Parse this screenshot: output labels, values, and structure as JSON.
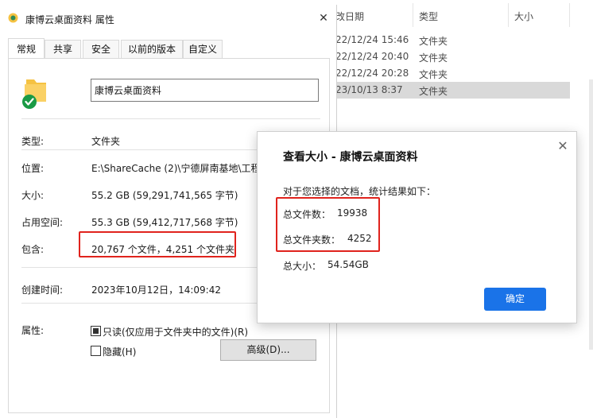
{
  "explorer": {
    "columns": {
      "date": "改日期",
      "type": "类型",
      "size": "大小"
    },
    "rows": [
      {
        "date": "22/12/24 15:46",
        "type": "文件夹",
        "selected": false
      },
      {
        "date": "22/12/24 20:40",
        "type": "文件夹",
        "selected": false
      },
      {
        "date": "22/12/24 20:28",
        "type": "文件夹",
        "selected": false
      },
      {
        "date": "23/10/13 8:37",
        "type": "文件夹",
        "selected": true
      }
    ]
  },
  "properties": {
    "title": "康博云桌面资料 属性",
    "tabs": [
      "常规",
      "共享",
      "安全",
      "以前的版本",
      "自定义"
    ],
    "active_tab": "常规",
    "folder_name": "康博云桌面资料",
    "type_label": "类型:",
    "type_value": "文件夹",
    "location_label": "位置:",
    "location_value": "E:\\ShareCache (2)\\宁德屏南基地\\工程",
    "size_label": "大小:",
    "size_value": "55.2 GB (59,291,741,565 字节)",
    "disk_label": "占用空间:",
    "disk_value": "55.3 GB (59,412,717,568 字节)",
    "contains_label": "包含:",
    "contains_value": "20,767 个文件，4,251 个文件夹",
    "created_label": "创建时间:",
    "created_value": "2023年10月12日，14:09:42",
    "attributes_label": "属性:",
    "readonly_label": "只读(仅应用于文件夹中的文件)(R)",
    "readonly_checked": true,
    "hidden_label": "隐藏(H)",
    "hidden_checked": false,
    "advanced_label": "高级(D)..."
  },
  "popup": {
    "title": "查看大小 - 康博云桌面资料",
    "intro": "对于您选择的文档，统计结果如下：",
    "file_count_label": "总文件数：",
    "file_count": "19938",
    "folder_count_label": "总文件夹数：",
    "folder_count": "4252",
    "total_size_label": "总大小：",
    "total_size": "54.54GB",
    "ok_label": "确定"
  },
  "colors": {
    "highlight": "#e0231d",
    "ok_button": "#1a73e8",
    "selected_row": "#d9d9d9"
  }
}
